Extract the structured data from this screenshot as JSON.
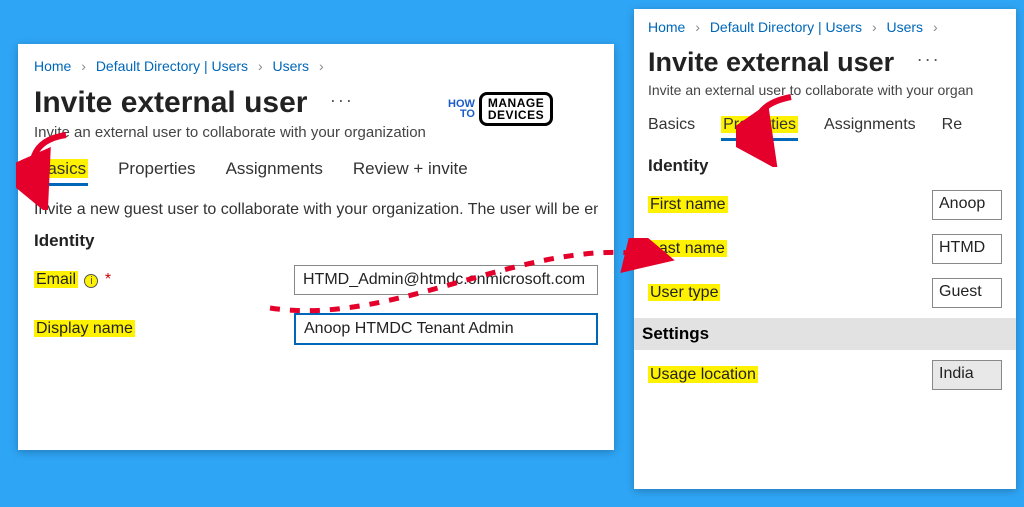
{
  "breadcrumb": {
    "home": "Home",
    "dir": "Default Directory | Users",
    "users": "Users"
  },
  "page": {
    "title": "Invite external user",
    "subtitle_left": "Invite an external user to collaborate with your organization",
    "subtitle_right": "Invite an external user to collaborate with your organ",
    "ellipsis": "···"
  },
  "tabs": {
    "basics": "Basics",
    "properties": "Properties",
    "assignments": "Assignments",
    "review": "Review + invite",
    "re": "Re"
  },
  "left": {
    "desc": "Invite a new guest user to collaborate with your organization. The user will be ema",
    "identity_head": "Identity",
    "email_label": "Email",
    "email_info": "i",
    "email_req": "*",
    "email_value": "HTMD_Admin@htmdc.onmicrosoft.com",
    "display_label": "Display name",
    "display_value": "Anoop HTMDC Tenant Admin"
  },
  "right": {
    "identity_head": "Identity",
    "firstname_label": "First name",
    "firstname_value": "Anoop",
    "lastname_label": "Last name",
    "lastname_value": "HTMD",
    "usertype_label": "User type",
    "usertype_value": "Guest",
    "settings_head": "Settings",
    "usage_label": "Usage location",
    "usage_value": "India"
  },
  "logo": {
    "how": "HOW",
    "to": "TO",
    "manage": "MANAGE",
    "devices": "DEVICES"
  }
}
